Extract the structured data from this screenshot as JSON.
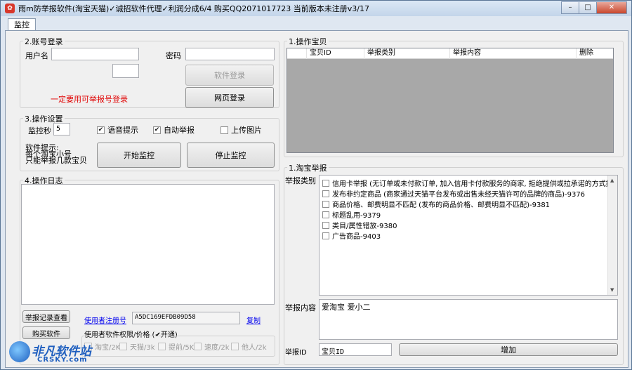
{
  "window": {
    "title": "雨m防举报软件(淘宝天猫)✓诚招软件代理✓利润分成6/4  购买QQ2071017723 当前版本未注册v3/17",
    "minimize": "–",
    "maximize": "□",
    "close": "✕"
  },
  "tabs": [
    {
      "label": "监控"
    }
  ],
  "account": {
    "title": "2.账号登录",
    "username_label": "用户名",
    "username_value": "",
    "password_label": "密码",
    "password_value": "",
    "small_value": "",
    "software_login": "软件登录",
    "web_login": "网页登录",
    "warning": "一定要用可举报号登录"
  },
  "settings": {
    "title": "3.操作设置",
    "interval_label": "监控秒",
    "interval_value": "5",
    "voice_prompt": "语音提示",
    "auto_report": "自动举报",
    "upload_image": "上传图片",
    "tip_line1": "软件提示:",
    "tip_line2": "每个淘宝小号",
    "tip_line3": "只能举报几款宝贝",
    "start_monitor": "开始监控",
    "stop_monitor": "停止监控"
  },
  "log": {
    "title": "4.操作日志",
    "records_button": "举报记录查看",
    "buy_button": "购买软件",
    "reg_link": "使用者注册号",
    "reg_code": "A5DC169EFDB09D58",
    "copy_link": "复制",
    "perm_title": "使用者软件权限/价格 (✔开通)",
    "perms": [
      "淘宝/2K",
      "天猫/3k",
      "提前/5K",
      "速度/2k",
      "他人/2k"
    ]
  },
  "items": {
    "title": "1.操作宝贝",
    "columns": [
      "宝贝ID",
      "举报类别",
      "举报内容",
      "删除"
    ]
  },
  "report": {
    "title": "1.淘宝举报",
    "category_label": "举报类别",
    "categories": [
      "信用卡举报 (无订单或未付款订单, 加入信用卡付款服务的商家, 拒绝提供或拉承诺的方式提",
      "发布非约定商品 (商家通过天猫平台发布或出售未经天猫许可的品牌的商品)-9376",
      "商品价格、邮费明显不匹配 (发布的商品价格、邮费明显不匹配)-9381",
      "标题乱用-9379",
      "类目/属性错放-9380",
      "广告商品-9403"
    ],
    "content_label": "举报内容",
    "content_value": "爱淘宝 爱小二",
    "id_label": "举报ID",
    "id_value": "宝贝ID",
    "add_button": "增加"
  },
  "watermark": {
    "text": "非凡软件站",
    "sub": "CRSKY.com"
  }
}
